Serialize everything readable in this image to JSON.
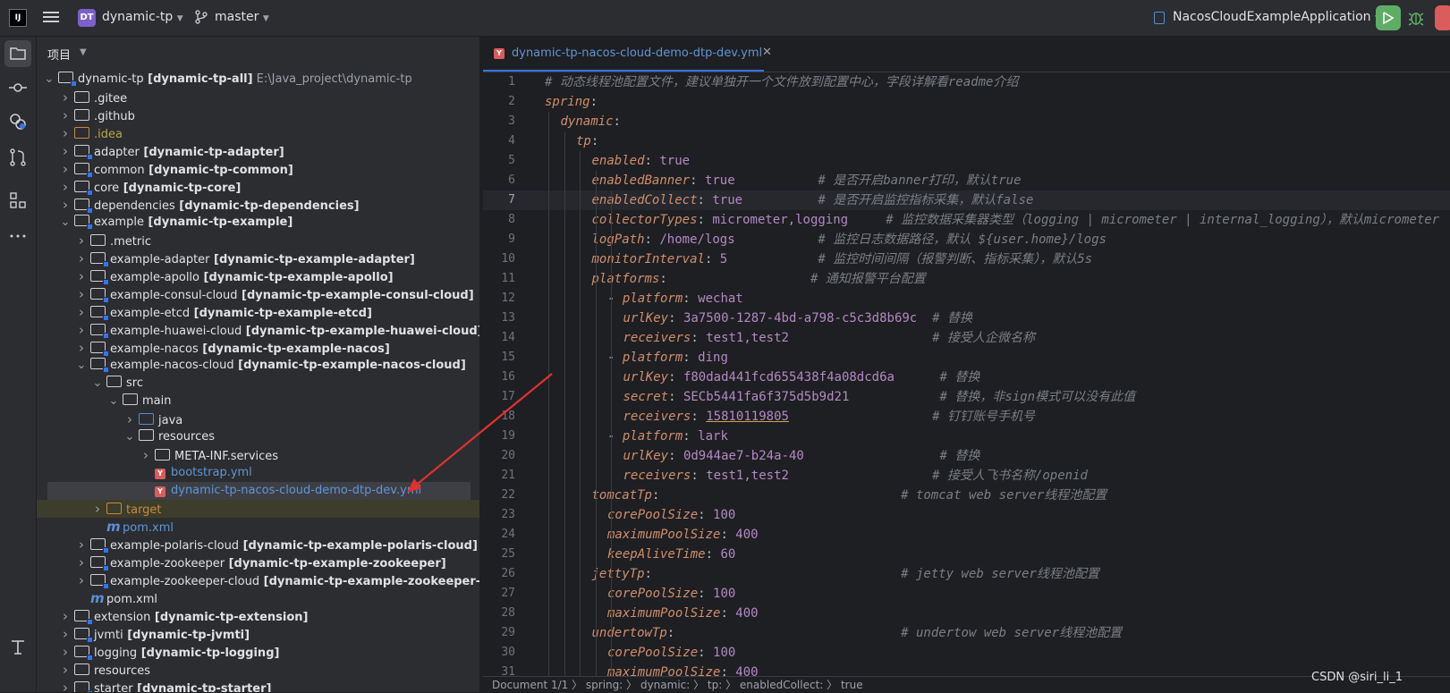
{
  "titlebar": {
    "logo": "IJ",
    "project_badge": "DT",
    "project_name": "dynamic-tp",
    "branch": "master",
    "run_config": "NacosCloudExampleApplication",
    "icons": [
      "menu-icon",
      "branch-icon",
      "chevron-down-icon",
      "run-icon",
      "debug-icon",
      "stop-icon"
    ]
  },
  "left_toolbar": {
    "icons": [
      "project-icon",
      "commit-icon",
      "services-icon",
      "pull-request-icon",
      "structure-icon",
      "more-icon",
      "terminal-icon"
    ]
  },
  "project_panel": {
    "title": "项目",
    "tree": [
      {
        "indent": 0,
        "arrow": "open",
        "icon": "module",
        "name": "dynamic-tp",
        "module": "[dynamic-tp-all]",
        "path": "E:\\Java_project\\dynamic-tp",
        "style": "norm"
      },
      {
        "indent": 1,
        "arrow": "closed",
        "icon": "folder",
        "name": ".gitee",
        "style": "norm"
      },
      {
        "indent": 1,
        "arrow": "closed",
        "icon": "folder",
        "name": ".github",
        "style": "norm"
      },
      {
        "indent": 1,
        "arrow": "closed",
        "icon": "folder-yellow",
        "name": ".idea",
        "style": "idea"
      },
      {
        "indent": 1,
        "arrow": "closed",
        "icon": "module",
        "name": "adapter",
        "module": "[dynamic-tp-adapter]",
        "style": "norm"
      },
      {
        "indent": 1,
        "arrow": "closed",
        "icon": "module",
        "name": "common",
        "module": "[dynamic-tp-common]",
        "style": "norm"
      },
      {
        "indent": 1,
        "arrow": "closed",
        "icon": "module",
        "name": "core",
        "module": "[dynamic-tp-core]",
        "style": "norm"
      },
      {
        "indent": 1,
        "arrow": "closed",
        "icon": "module",
        "name": "dependencies",
        "module": "[dynamic-tp-dependencies]",
        "style": "norm"
      },
      {
        "indent": 1,
        "arrow": "open",
        "icon": "module",
        "name": "example",
        "module": "[dynamic-tp-example]",
        "style": "norm"
      },
      {
        "indent": 2,
        "arrow": "closed",
        "icon": "folder",
        "name": ".metric",
        "style": "norm"
      },
      {
        "indent": 2,
        "arrow": "closed",
        "icon": "module",
        "name": "example-adapter",
        "module": "[dynamic-tp-example-adapter]",
        "style": "norm"
      },
      {
        "indent": 2,
        "arrow": "closed",
        "icon": "module",
        "name": "example-apollo",
        "module": "[dynamic-tp-example-apollo]",
        "style": "norm"
      },
      {
        "indent": 2,
        "arrow": "closed",
        "icon": "module",
        "name": "example-consul-cloud",
        "module": "[dynamic-tp-example-consul-cloud]",
        "style": "norm"
      },
      {
        "indent": 2,
        "arrow": "closed",
        "icon": "module",
        "name": "example-etcd",
        "module": "[dynamic-tp-example-etcd]",
        "style": "norm"
      },
      {
        "indent": 2,
        "arrow": "closed",
        "icon": "module",
        "name": "example-huawei-cloud",
        "module": "[dynamic-tp-example-huawei-cloud]",
        "style": "norm"
      },
      {
        "indent": 2,
        "arrow": "closed",
        "icon": "module",
        "name": "example-nacos",
        "module": "[dynamic-tp-example-nacos]",
        "style": "norm"
      },
      {
        "indent": 2,
        "arrow": "open",
        "icon": "module",
        "name": "example-nacos-cloud",
        "module": "[dynamic-tp-example-nacos-cloud]",
        "style": "norm"
      },
      {
        "indent": 3,
        "arrow": "open",
        "icon": "folder",
        "name": "src",
        "style": "norm"
      },
      {
        "indent": 4,
        "arrow": "open",
        "icon": "folder",
        "name": "main",
        "style": "norm"
      },
      {
        "indent": 5,
        "arrow": "closed",
        "icon": "folder-src",
        "name": "java",
        "style": "norm"
      },
      {
        "indent": 5,
        "arrow": "open",
        "icon": "folder-res",
        "name": "resources",
        "style": "norm"
      },
      {
        "indent": 6,
        "arrow": "closed",
        "icon": "folder",
        "name": "META-INF.services",
        "style": "norm"
      },
      {
        "indent": 6,
        "arrow": "none",
        "icon": "yaml",
        "name": "bootstrap.yml",
        "style": "yml"
      },
      {
        "indent": 6,
        "arrow": "none",
        "icon": "yaml",
        "name": "dynamic-tp-nacos-cloud-demo-dtp-dev.yml",
        "style": "yml",
        "selected": true
      },
      {
        "indent": 3,
        "arrow": "closed",
        "icon": "folder-target",
        "name": "target",
        "style": "tgt",
        "excluded": true
      },
      {
        "indent": 3,
        "arrow": "none",
        "icon": "maven",
        "name": "pom.xml",
        "style": "pom"
      },
      {
        "indent": 2,
        "arrow": "closed",
        "icon": "module",
        "name": "example-polaris-cloud",
        "module": "[dynamic-tp-example-polaris-cloud]",
        "style": "norm"
      },
      {
        "indent": 2,
        "arrow": "closed",
        "icon": "module",
        "name": "example-zookeeper",
        "module": "[dynamic-tp-example-zookeeper]",
        "style": "norm"
      },
      {
        "indent": 2,
        "arrow": "closed",
        "icon": "module",
        "name": "example-zookeeper-cloud",
        "module": "[dynamic-tp-example-zookeeper-cloud]",
        "style": "norm"
      },
      {
        "indent": 2,
        "arrow": "none",
        "icon": "maven",
        "name": "pom.xml",
        "style": "norm"
      },
      {
        "indent": 1,
        "arrow": "closed",
        "icon": "module",
        "name": "extension",
        "module": "[dynamic-tp-extension]",
        "style": "norm"
      },
      {
        "indent": 1,
        "arrow": "closed",
        "icon": "module",
        "name": "jvmti",
        "module": "[dynamic-tp-jvmti]",
        "style": "norm"
      },
      {
        "indent": 1,
        "arrow": "closed",
        "icon": "module",
        "name": "logging",
        "module": "[dynamic-tp-logging]",
        "style": "norm"
      },
      {
        "indent": 1,
        "arrow": "closed",
        "icon": "folder",
        "name": "resources",
        "style": "norm"
      },
      {
        "indent": 1,
        "arrow": "closed",
        "icon": "module",
        "name": "starter",
        "module": "[dynamic-tp-starter]",
        "style": "norm"
      }
    ]
  },
  "editor": {
    "tab_label": "dynamic-tp-nacos-cloud-demo-dtp-dev.yml",
    "current_line": 7,
    "lines": [
      {
        "n": "1",
        "indent": 0,
        "comment": "# 动态线程池配置文件，建议单独开一个文件放到配置中心，字段详解看readme介绍"
      },
      {
        "n": "2",
        "indent": 0,
        "key": "spring",
        "colon": ":"
      },
      {
        "n": "3",
        "indent": 1,
        "key": "dynamic",
        "colon": ":"
      },
      {
        "n": "4",
        "indent": 2,
        "key": "tp",
        "colon": ":"
      },
      {
        "n": "5",
        "indent": 3,
        "key": "enabled",
        "colon": ": ",
        "value": "true"
      },
      {
        "n": "6",
        "indent": 3,
        "key": "enabledBanner",
        "colon": ": ",
        "value": "true",
        "pad": "           ",
        "comment": "# 是否开启banner打印，默认true"
      },
      {
        "n": "7",
        "indent": 3,
        "key": "enabledCollect",
        "colon": ": ",
        "value": "true",
        "pad": "          ",
        "comment": "# 是否开启监控指标采集，默认false"
      },
      {
        "n": "8",
        "indent": 3,
        "key": "collectorTypes",
        "colon": ": ",
        "value": "micrometer,logging",
        "pad": "     ",
        "comment": "# 监控数据采集器类型（logging | micrometer | internal_logging），默认micrometer"
      },
      {
        "n": "9",
        "indent": 3,
        "key": "logPath",
        "colon": ": ",
        "value": "/home/logs",
        "pad": "           ",
        "comment": "# 监控日志数据路径，默认 ${user.home}/logs"
      },
      {
        "n": "10",
        "indent": 3,
        "key": "monitorInterval",
        "colon": ": ",
        "value": "5",
        "pad": "            ",
        "comment": "# 监控时间间隔（报警判断、指标采集），默认5s"
      },
      {
        "n": "11",
        "indent": 3,
        "key": "platforms",
        "colon": ":",
        "pad": "                   ",
        "comment": "# 通知报警平台配置"
      },
      {
        "n": "12",
        "indent": 4,
        "dash": "- ",
        "key": "platform",
        "colon": ": ",
        "value": "wechat"
      },
      {
        "n": "13",
        "indent": 5,
        "key": "urlKey",
        "colon": ": ",
        "value": "3a7500-1287-4bd-a798-c5c3d8b69c",
        "pad": "  ",
        "comment": "# 替换"
      },
      {
        "n": "14",
        "indent": 5,
        "key": "receivers",
        "colon": ": ",
        "value": "test1,test2",
        "pad": "                   ",
        "comment": "# 接受人企微名称"
      },
      {
        "n": "15",
        "indent": 4,
        "dash": "- ",
        "key": "platform",
        "colon": ": ",
        "value": "ding"
      },
      {
        "n": "16",
        "indent": 5,
        "key": "urlKey",
        "colon": ": ",
        "value": "f80dad441fcd655438f4a08dcd6a",
        "pad": "      ",
        "comment": "# 替换"
      },
      {
        "n": "17",
        "indent": 5,
        "key": "secret",
        "colon": ": ",
        "value": "SECb5441fa6f375d5b9d21",
        "pad": "            ",
        "comment": "# 替换，非sign模式可以没有此值"
      },
      {
        "n": "18",
        "indent": 5,
        "key": "receivers",
        "colon": ": ",
        "value": "15810119805",
        "underline": true,
        "pad": "                   ",
        "comment": "# 钉钉账号手机号"
      },
      {
        "n": "19",
        "indent": 4,
        "dash": "- ",
        "key": "platform",
        "colon": ": ",
        "value": "lark"
      },
      {
        "n": "20",
        "indent": 5,
        "key": "urlKey",
        "colon": ": ",
        "value": "0d944ae7-b24a-40",
        "pad": "                  ",
        "comment": "# 替换"
      },
      {
        "n": "21",
        "indent": 5,
        "key": "receivers",
        "colon": ": ",
        "value": "test1,test2",
        "pad": "                   ",
        "comment": "# 接受人飞书名称/openid"
      },
      {
        "n": "22",
        "indent": 3,
        "key": "tomcatTp",
        "colon": ":",
        "pad": "                                ",
        "comment": "# tomcat web server线程池配置"
      },
      {
        "n": "23",
        "indent": 4,
        "key": "corePoolSize",
        "colon": ": ",
        "value": "100"
      },
      {
        "n": "24",
        "indent": 4,
        "key": "maximumPoolSize",
        "colon": ": ",
        "value": "400"
      },
      {
        "n": "25",
        "indent": 4,
        "key": "keepAliveTime",
        "colon": ": ",
        "value": "60"
      },
      {
        "n": "26",
        "indent": 3,
        "key": "jettyTp",
        "colon": ":",
        "pad": "                                 ",
        "comment": "# jetty web server线程池配置"
      },
      {
        "n": "27",
        "indent": 4,
        "key": "corePoolSize",
        "colon": ": ",
        "value": "100"
      },
      {
        "n": "28",
        "indent": 4,
        "key": "maximumPoolSize",
        "colon": ": ",
        "value": "400"
      },
      {
        "n": "29",
        "indent": 3,
        "key": "undertowTp",
        "colon": ":",
        "pad": "                              ",
        "comment": "# undertow web server线程池配置"
      },
      {
        "n": "30",
        "indent": 4,
        "key": "corePoolSize",
        "colon": ": ",
        "value": "100"
      },
      {
        "n": "31",
        "indent": 4,
        "key": "maximumPoolSize",
        "colon": ": ",
        "value": "400"
      }
    ]
  },
  "statusbar": {
    "text": "Document 1/1  〉 spring:  〉 dynamic:  〉 tp:  〉 enabledCollect:  〉 true"
  },
  "watermark": "CSDN @siri_li_1",
  "colors": {
    "accent": "#3574f0",
    "annotation_arrow": "#e0312e",
    "yaml_key": "#cf8e6d",
    "yaml_value": "#b389c5",
    "comment": "#7a7e85"
  }
}
